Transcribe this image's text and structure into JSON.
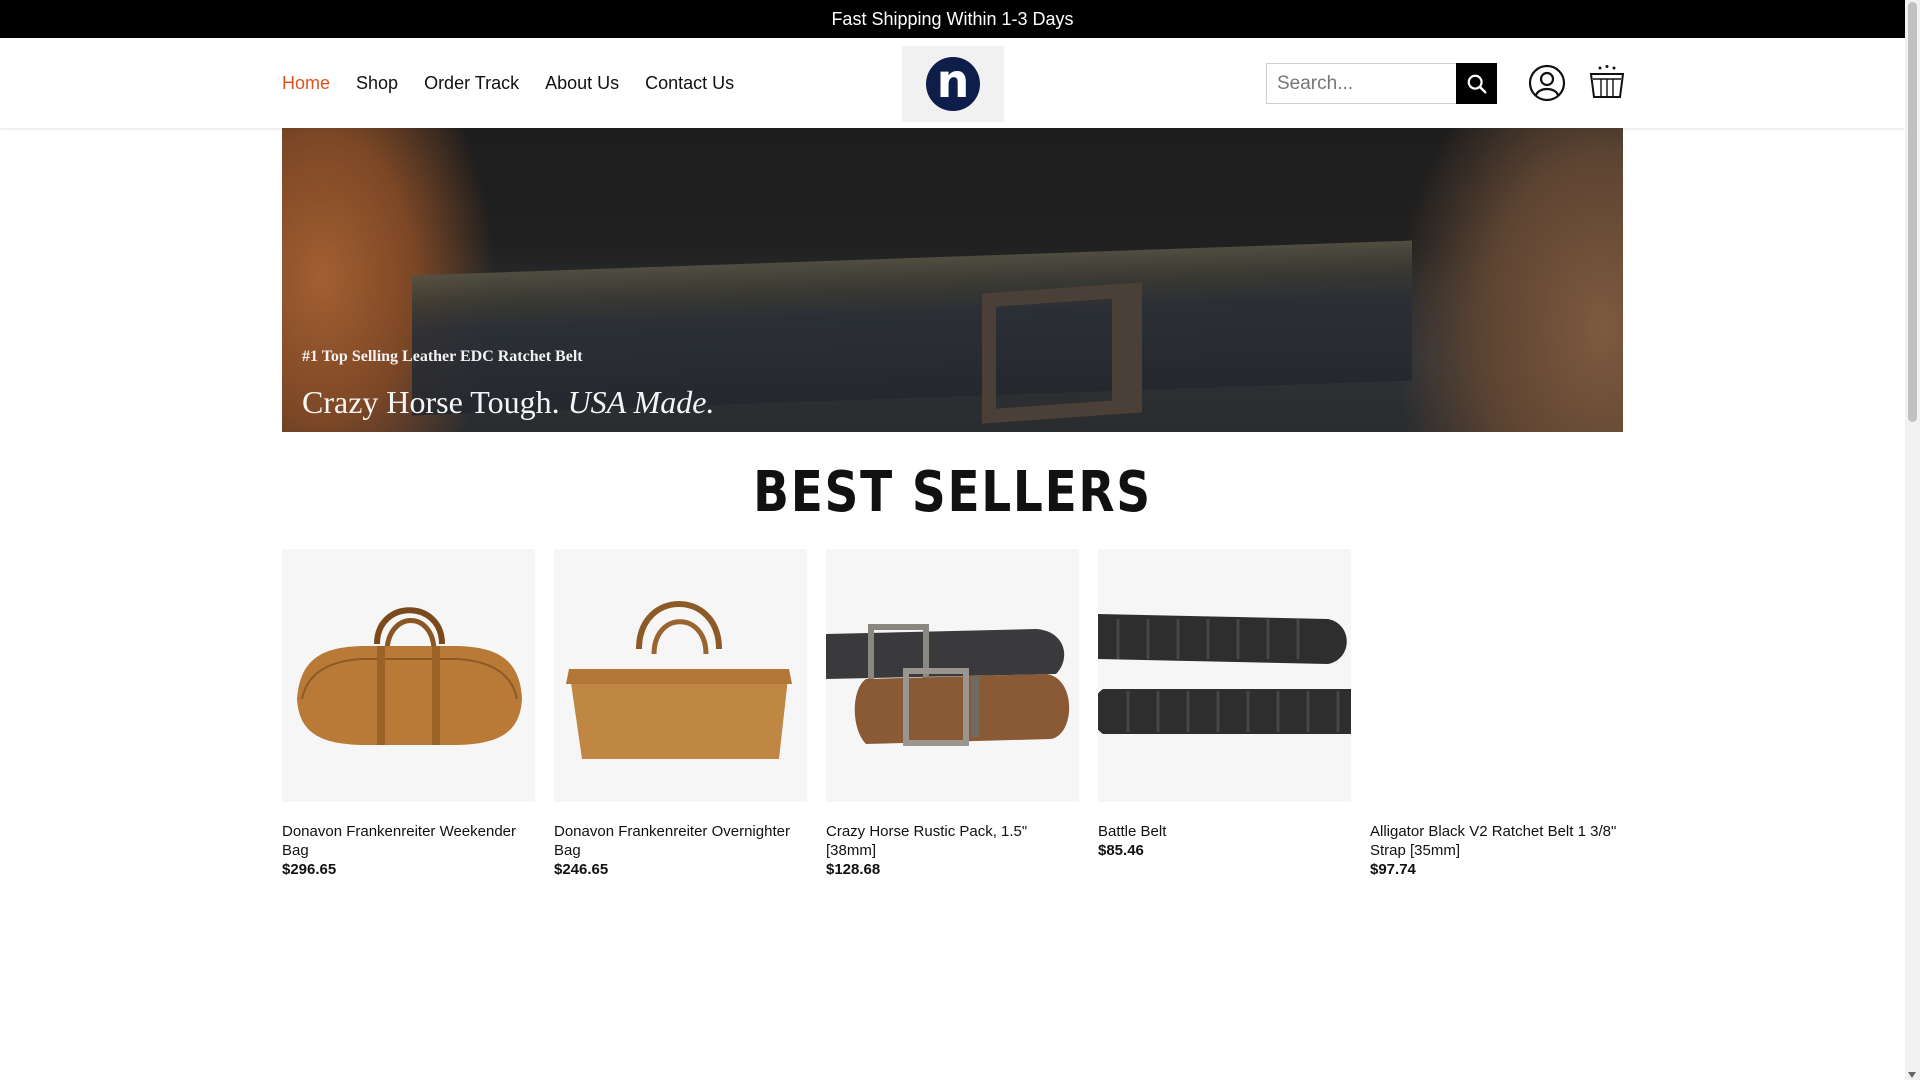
{
  "announcement": "Fast Shipping Within 1-3 Days",
  "nav": {
    "items": [
      "Home",
      "Shop",
      "Order Track",
      "About Us",
      "Contact Us"
    ]
  },
  "logo": {
    "letter": "n",
    "color": "#0f1d4a"
  },
  "search": {
    "placeholder": "Search...",
    "icon": "search-icon"
  },
  "header_icons": {
    "account": "user-circle-icon",
    "cart": "shopping-cart-icon"
  },
  "banner": {
    "tagline": "#1 Top Selling Leather EDC Ratchet Belt",
    "headline_main": "Crazy Horse Tough.",
    "headline_em": "USA Made."
  },
  "best_sellers": {
    "title": "BEST SELLERS",
    "products": [
      {
        "name": "Donavon Frankenreiter Weekender Bag",
        "price": "$296.65"
      },
      {
        "name": "Donavon Frankenreiter Overnighter Bag",
        "price": "$246.65"
      },
      {
        "name": "Crazy Horse Rustic Pack, 1.5\" [38mm]",
        "price": "$128.68"
      },
      {
        "name": "Battle Belt",
        "price": "$85.46"
      },
      {
        "name": "Alligator Black V2 Ratchet Belt 1 3/8\" Strap [35mm]",
        "price": "$97.74"
      }
    ]
  },
  "colors": {
    "accent": "#e0521c",
    "announcement_bg": "#000000"
  }
}
